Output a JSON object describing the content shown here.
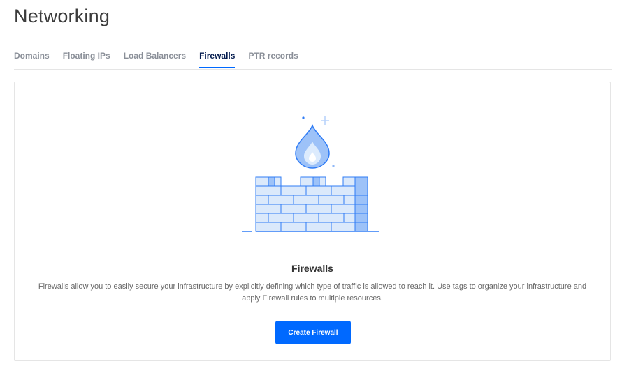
{
  "page": {
    "title": "Networking"
  },
  "tabs": [
    {
      "label": "Domains",
      "active": false
    },
    {
      "label": "Floating IPs",
      "active": false
    },
    {
      "label": "Load Balancers",
      "active": false
    },
    {
      "label": "Firewalls",
      "active": true
    },
    {
      "label": "PTR records",
      "active": false
    }
  ],
  "empty_state": {
    "illustration": "firewall-brick-wall-with-flame-icon",
    "title": "Firewalls",
    "description": "Firewalls allow you to easily secure your infrastructure by explicitly defining which type of traffic is allowed to reach it. Use tags to organize your infrastructure and apply Firewall rules to multiple resources.",
    "button_label": "Create Firewall"
  },
  "colors": {
    "accent": "#0069ff",
    "active_tab_text": "#031b4e",
    "inactive_tab_text": "#8a8f98",
    "illustration_fill": "#dbe9fb",
    "illustration_stroke": "#2f7cf6"
  }
}
